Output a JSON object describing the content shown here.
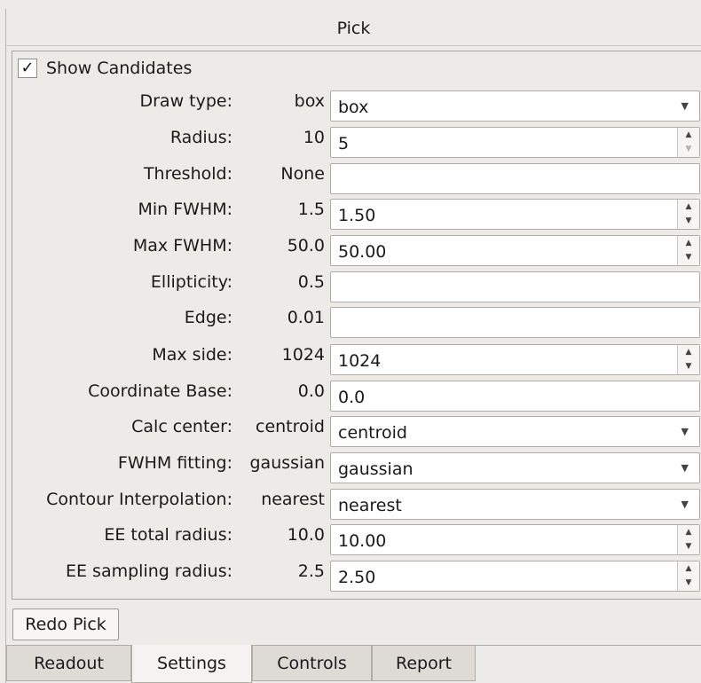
{
  "title": "Pick",
  "show_candidates": {
    "label": "Show Candidates",
    "checked": true,
    "mark": "✓"
  },
  "rows": [
    {
      "label": "Draw type:",
      "value": "box",
      "field": "box",
      "kind": "combo"
    },
    {
      "label": "Radius:",
      "value": "10",
      "field": "5",
      "kind": "spin",
      "up_disabled": false,
      "down_disabled": true
    },
    {
      "label": "Threshold:",
      "value": "None",
      "field": "",
      "kind": "text"
    },
    {
      "label": "Min FWHM:",
      "value": "1.5",
      "field": "1.50",
      "kind": "spin"
    },
    {
      "label": "Max FWHM:",
      "value": "50.0",
      "field": "50.00",
      "kind": "spin"
    },
    {
      "label": "Ellipticity:",
      "value": "0.5",
      "field": "",
      "kind": "text"
    },
    {
      "label": "Edge:",
      "value": "0.01",
      "field": "",
      "kind": "text"
    },
    {
      "label": "Max side:",
      "value": "1024",
      "field": "1024",
      "kind": "spin"
    },
    {
      "label": "Coordinate Base:",
      "value": "0.0",
      "field": "0.0",
      "kind": "text"
    },
    {
      "label": "Calc center:",
      "value": "centroid",
      "field": "centroid",
      "kind": "combo"
    },
    {
      "label": "FWHM fitting:",
      "value": "gaussian",
      "field": "gaussian",
      "kind": "combo"
    },
    {
      "label": "Contour Interpolation:",
      "value": "nearest",
      "field": "nearest",
      "kind": "combo"
    },
    {
      "label": "EE total radius:",
      "value": "10.0",
      "field": "10.00",
      "kind": "spin"
    },
    {
      "label": "EE sampling radius:",
      "value": "2.5",
      "field": "2.50",
      "kind": "spin"
    }
  ],
  "redo_button": "Redo Pick",
  "tabs": [
    {
      "label": "Readout",
      "active": false
    },
    {
      "label": "Settings",
      "active": true
    },
    {
      "label": "Controls",
      "active": false
    },
    {
      "label": "Report",
      "active": false
    }
  ],
  "icons": {
    "combo_arrow": "chevron-down-icon",
    "spin_up": "spin-up-icon",
    "spin_down": "spin-down-icon",
    "check": "checkmark-icon"
  }
}
